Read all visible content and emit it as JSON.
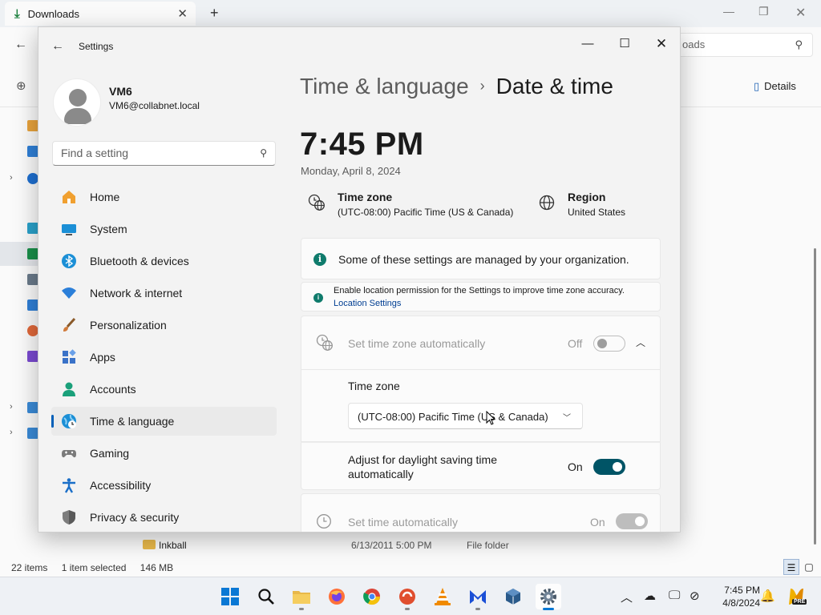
{
  "explorer": {
    "tab_title": "Downloads",
    "search_placeholder": "oads",
    "details_label": "Details",
    "row": {
      "name": "Inkball",
      "date": "6/13/2011 5:00 PM",
      "type": "File folder"
    },
    "status": {
      "items": "22 items",
      "selected": "1 item selected",
      "size": "146 MB"
    }
  },
  "settings": {
    "window_title": "Settings",
    "profile": {
      "name": "VM6",
      "email": "VM6@collabnet.local"
    },
    "search_placeholder": "Find a setting",
    "nav": [
      {
        "label": "Home",
        "icon": "home-icon",
        "color": "#f0a030"
      },
      {
        "label": "System",
        "icon": "monitor-icon",
        "color": "#1b8fd6"
      },
      {
        "label": "Bluetooth & devices",
        "icon": "bluetooth-icon",
        "color": "#1b8fd6"
      },
      {
        "label": "Network & internet",
        "icon": "wifi-icon",
        "color": "#2b7fd9"
      },
      {
        "label": "Personalization",
        "icon": "brush-icon",
        "color": "#d07a3a"
      },
      {
        "label": "Apps",
        "icon": "apps-icon",
        "color": "#3a72c8"
      },
      {
        "label": "Accounts",
        "icon": "person-icon",
        "color": "#1aa07a"
      },
      {
        "label": "Time & language",
        "icon": "globe-clock-icon",
        "color": "#1b8fd6",
        "active": true
      },
      {
        "label": "Gaming",
        "icon": "gamepad-icon",
        "color": "#7a7a7a"
      },
      {
        "label": "Accessibility",
        "icon": "accessibility-icon",
        "color": "#1b6fc8"
      },
      {
        "label": "Privacy & security",
        "icon": "shield-icon",
        "color": "#7d7d7d"
      }
    ],
    "breadcrumb": {
      "parent": "Time & language",
      "separator": "›",
      "current": "Date & time"
    },
    "clock": "7:45 PM",
    "date": "Monday, April 8, 2024",
    "time_zone": {
      "label": "Time zone",
      "value": "(UTC-08:00) Pacific Time (US & Canada)"
    },
    "region": {
      "label": "Region",
      "value": "United States"
    },
    "managed_banner": "Some of these settings are managed by your organization.",
    "location_banner": {
      "text": "Enable location permission for the Settings to improve time zone accuracy.",
      "link": "Location Settings"
    },
    "set_tz_auto": {
      "label": "Set time zone automatically",
      "state": "Off"
    },
    "tz_picker": {
      "label": "Time zone",
      "value": "(UTC-08:00) Pacific Time (US & Canada)"
    },
    "dst": {
      "label": "Adjust for daylight saving time automatically",
      "state": "On"
    },
    "set_time_auto": {
      "label": "Set time automatically",
      "state": "On"
    }
  },
  "taskbar": {
    "clock_time": "7:45 PM",
    "clock_date": "4/8/2024",
    "badge": "PRE"
  }
}
